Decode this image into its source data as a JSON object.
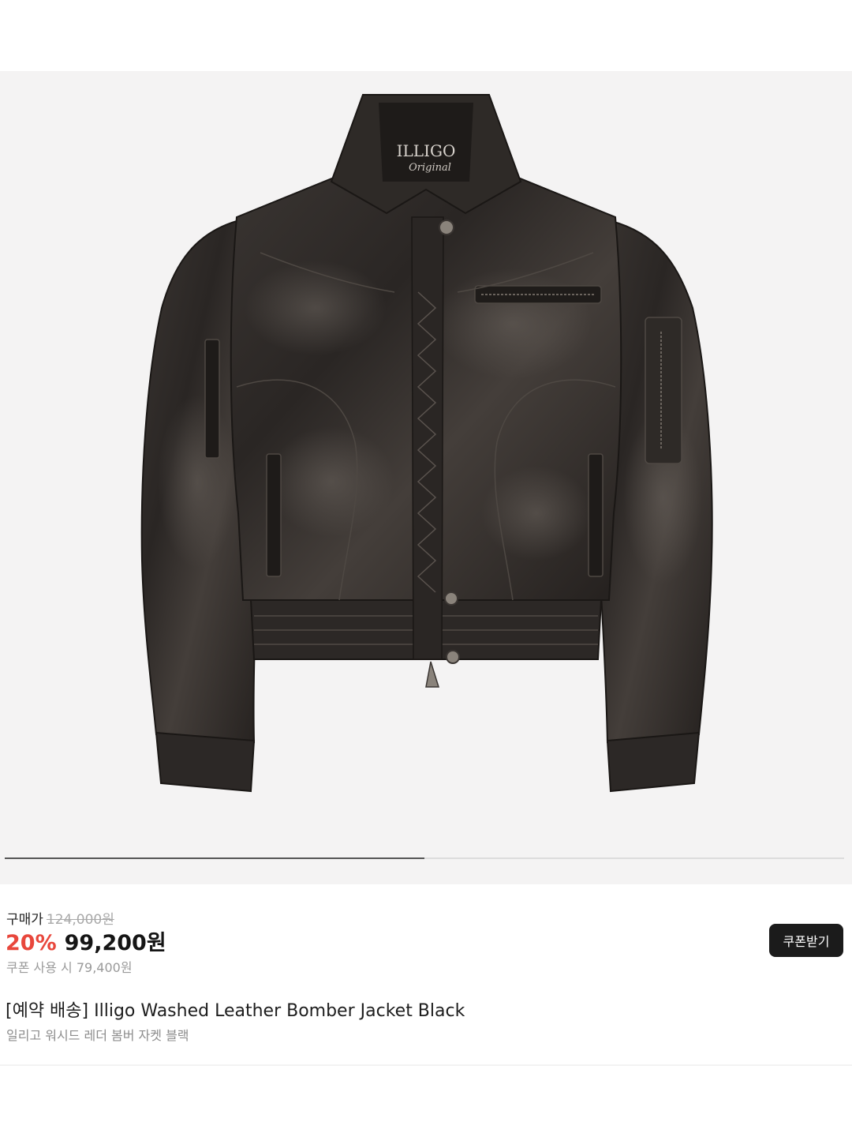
{
  "gallery": {
    "image_alt": "Illigo Washed Leather Bomber Jacket Black",
    "progress": 0.5,
    "label_text": "ILLIGO",
    "label_script": "Original"
  },
  "pricing": {
    "label": "구매가",
    "original_price": "124,000원",
    "discount": "20%",
    "sale_price": "99,200원",
    "coupon_price": "쿠폰 사용 시 79,400원",
    "coupon_button": "쿠폰받기"
  },
  "product": {
    "name": "[예약 배송] Illigo Washed Leather Bomber Jacket Black",
    "subname": "일리고 워시드 레더 봄버 자켓 블랙"
  },
  "colors": {
    "discount": "#e8473c",
    "button_bg": "#1b1b1b",
    "gallery_bg": "#f4f3f3"
  }
}
